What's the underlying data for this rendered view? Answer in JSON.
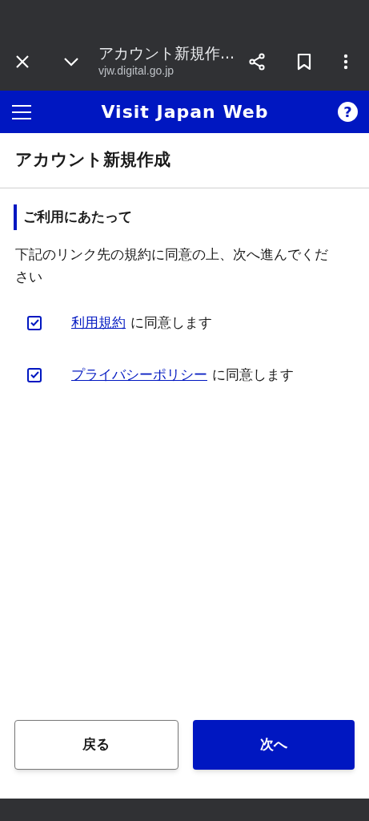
{
  "browser_bar": {
    "title": "アカウント新規作...",
    "url": "vjw.digital.go.jp"
  },
  "header": {
    "title": "Visit Japan Web",
    "help": "?"
  },
  "page_title": "アカウント新規作成",
  "section": {
    "heading": "ご利用にあたって",
    "description": "下記のリンク先の規約に同意の上、次へ進んでください"
  },
  "agreements": [
    {
      "link": "利用規約",
      "suffix": "に同意します",
      "checked": true
    },
    {
      "link": "プライバシーポリシー",
      "suffix": "に同意します",
      "checked": true
    }
  ],
  "buttons": [
    {
      "label": "戻る",
      "kind": "secondary"
    },
    {
      "label": "次へ",
      "kind": "primary"
    }
  ]
}
